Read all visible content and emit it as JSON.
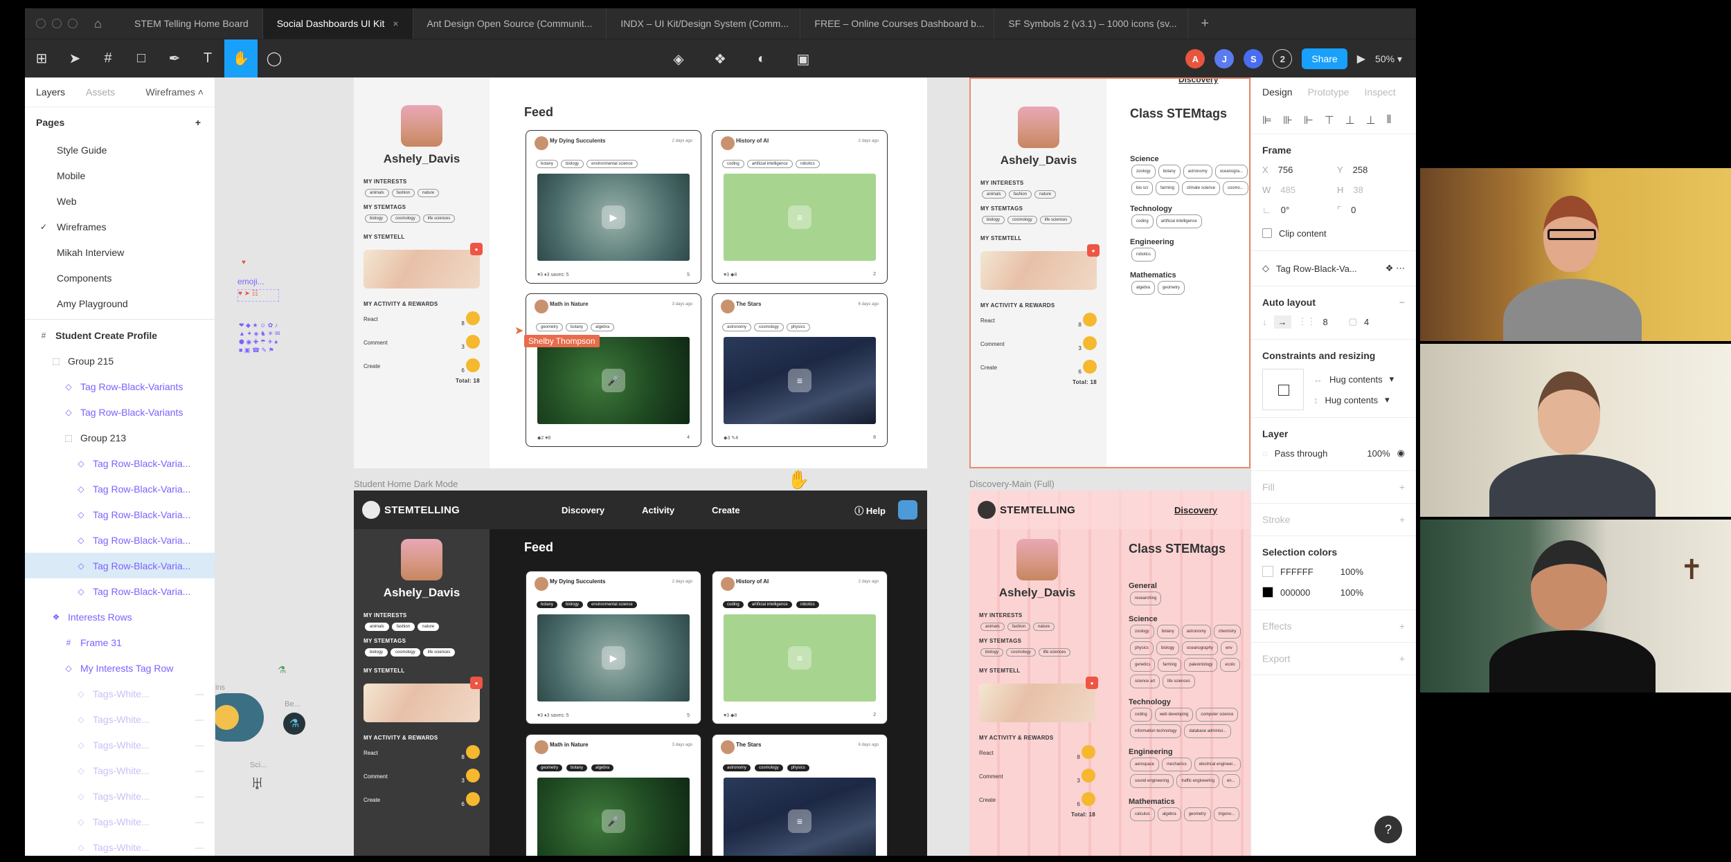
{
  "tabs": [
    {
      "label": "STEM Telling Home Board"
    },
    {
      "label": "Social Dashboards UI Kit",
      "close": "×"
    },
    {
      "label": "Ant Design Open Source (Communit..."
    },
    {
      "label": "INDX – UI Kit/Design System (Comm..."
    },
    {
      "label": "FREE – Online Courses Dashboard b..."
    },
    {
      "label": "SF Symbols 2 (v3.1) – 1000 icons (sv..."
    }
  ],
  "toolbar": {
    "avatars": [
      {
        "letter": "A",
        "color": "#e8553e"
      },
      {
        "letter": "J",
        "color": "#5b7bf0"
      },
      {
        "letter": "S",
        "color": "#4a6cf0"
      }
    ],
    "more_count": "2",
    "share_label": "Share",
    "zoom": "50%"
  },
  "left_panel": {
    "tabs": {
      "layers": "Layers",
      "assets": "Assets",
      "page": "Wireframes"
    },
    "pages_title": "Pages",
    "pages": [
      "Style Guide",
      "Mobile",
      "Web",
      "Wireframes",
      "Mikah Interview",
      "Components",
      "Amy Playground"
    ],
    "layers": [
      {
        "label": "Student Create Profile",
        "indent": 0,
        "kind": "frame"
      },
      {
        "label": "Group 215",
        "indent": 1,
        "kind": "group"
      },
      {
        "label": "Tag Row-Black-Variants",
        "indent": 2,
        "kind": "instance"
      },
      {
        "label": "Tag Row-Black-Variants",
        "indent": 2,
        "kind": "instance"
      },
      {
        "label": "Group 213",
        "indent": 2,
        "kind": "group"
      },
      {
        "label": "Tag Row-Black-Varia...",
        "indent": 3,
        "kind": "instance"
      },
      {
        "label": "Tag Row-Black-Varia...",
        "indent": 3,
        "kind": "instance"
      },
      {
        "label": "Tag Row-Black-Varia...",
        "indent": 3,
        "kind": "instance"
      },
      {
        "label": "Tag Row-Black-Varia...",
        "indent": 3,
        "kind": "instance"
      },
      {
        "label": "Tag Row-Black-Varia...",
        "indent": 3,
        "kind": "instance-selected"
      },
      {
        "label": "Tag Row-Black-Varia...",
        "indent": 3,
        "kind": "instance"
      },
      {
        "label": "Interests Rows",
        "indent": 1,
        "kind": "component"
      },
      {
        "label": "Frame 31",
        "indent": 2,
        "kind": "frame-purple"
      },
      {
        "label": "My Interests Tag Row",
        "indent": 2,
        "kind": "instance"
      },
      {
        "label": "Tags-White...",
        "indent": 3,
        "kind": "faded"
      },
      {
        "label": "Tags-White...",
        "indent": 3,
        "kind": "faded"
      },
      {
        "label": "Tags-White...",
        "indent": 3,
        "kind": "faded"
      },
      {
        "label": "Tags-White...",
        "indent": 3,
        "kind": "faded"
      },
      {
        "label": "Tags-White...",
        "indent": 3,
        "kind": "faded"
      },
      {
        "label": "Tags-White...",
        "indent": 3,
        "kind": "faded"
      },
      {
        "label": "Tags-White...",
        "indent": 3,
        "kind": "faded"
      }
    ]
  },
  "right_panel": {
    "tabs": {
      "design": "Design",
      "prototype": "Prototype",
      "inspect": "Inspect"
    },
    "frame_title": "Frame",
    "x": "756",
    "y": "258",
    "w": "485",
    "h": "38",
    "rotation": "0°",
    "radius": "0",
    "clip_content": "Clip content",
    "component": "Tag Row-Black-Va...",
    "auto_layout": "Auto layout",
    "al_spacing": "8",
    "al_padding": "4",
    "constraints": "Constraints and resizing",
    "hug1": "Hug contents",
    "hug2": "Hug contents",
    "layer": "Layer",
    "blend": "Pass through",
    "opacity": "100%",
    "fill": "Fill",
    "stroke": "Stroke",
    "selection_colors": "Selection colors",
    "colors": [
      {
        "hex": "FFFFFF",
        "pct": "100%",
        "swatch": "#ffffff"
      },
      {
        "hex": "000000",
        "pct": "100%",
        "swatch": "#000000"
      }
    ],
    "effects": "Effects",
    "export": "Export",
    "help": "?"
  },
  "canvas": {
    "cursor_name": "Shelby Thompson",
    "labels": {
      "dark": "Student Home Dark Mode",
      "pink": "Discovery-Main (Full)",
      "emoji": "emoji..."
    },
    "profile": {
      "name": "Ashely_Davis",
      "my_interests": "MY INTERESTS",
      "interests": [
        "animals",
        "fashion",
        "nature"
      ],
      "my_stemtags": "MY STEMTAGS",
      "stemtags": [
        "biology",
        "cosmology",
        "life sciences"
      ],
      "my_stemtell": "MY STEMTELL",
      "activity": "MY ACTIVITY & REWARDS",
      "react": "React",
      "comment": "Comment",
      "create": "Create",
      "react_n": "8",
      "comment_n": "3",
      "create_n": "6",
      "total": "Total: 18"
    },
    "feed": {
      "title": "Feed",
      "cards": [
        {
          "title": "My Dying Succulents",
          "date": "2 days ago",
          "tags": [
            "botany",
            "biology",
            "environmental science"
          ],
          "stats": "♥3  ♦3   saves: 5",
          "count": "5"
        },
        {
          "title": "History of AI",
          "date": "2 days ago",
          "tags": [
            "coding",
            "artificial intelligence",
            "robotics"
          ],
          "stats": "♥3  ◆8",
          "count": "2"
        },
        {
          "title": "Math in Nature",
          "date": "3 days ago",
          "tags": [
            "geometry",
            "botany",
            "algebra"
          ],
          "stats": "◆2  ♥8",
          "count": "4"
        },
        {
          "title": "The Stars",
          "date": "6 days ago",
          "tags": [
            "astronomy",
            "cosmology",
            "physics"
          ],
          "stats": "◆3  ✎4",
          "count": "8"
        }
      ]
    },
    "dark": {
      "brand": "STEMTELLING",
      "nav": [
        "Discovery",
        "Activity",
        "Create"
      ],
      "help": "Help"
    },
    "stemtags_frame": {
      "title": "Class STEMtags",
      "sections": [
        {
          "name": "Science",
          "tags": [
            "zoology",
            "botany",
            "astronomy",
            "oceanogra...",
            "bio sci",
            "farming",
            "climate science",
            "cosmo..."
          ]
        },
        {
          "name": "Technology",
          "tags": [
            "coding",
            "artificial intelligence"
          ]
        },
        {
          "name": "Engineering",
          "tags": [
            "robotics"
          ]
        },
        {
          "name": "Mathematics",
          "tags": [
            "algebra",
            "geometry"
          ]
        }
      ],
      "discovery": "Discovery"
    },
    "pink": {
      "brand": "STEMTELLING",
      "discovery": "Discovery",
      "title": "Class STEMtags",
      "sections": [
        {
          "name": "General",
          "tags": [
            "researching"
          ]
        },
        {
          "name": "Science",
          "tags": [
            "zoology",
            "botany",
            "astronomy",
            "chemistry",
            "physics",
            "biology",
            "oceanography",
            "env",
            "genetics",
            "farming",
            "paleontology",
            "ecolo",
            "science art",
            "life sciences"
          ]
        },
        {
          "name": "Technology",
          "tags": [
            "coding",
            "web developing",
            "computer science",
            "information technology",
            "database administ..."
          ]
        },
        {
          "name": "Engineering",
          "tags": [
            "aerospace",
            "mechanics",
            "electrical engineer...",
            "sound engineering",
            "traffic engineering",
            "en..."
          ]
        },
        {
          "name": "Mathematics",
          "tags": [
            "calculus",
            "algebra",
            "geometry",
            "trigono..."
          ]
        }
      ]
    },
    "side_labels": {
      "be": "Be...",
      "sci": "Sci...",
      "ins": "ins"
    }
  }
}
